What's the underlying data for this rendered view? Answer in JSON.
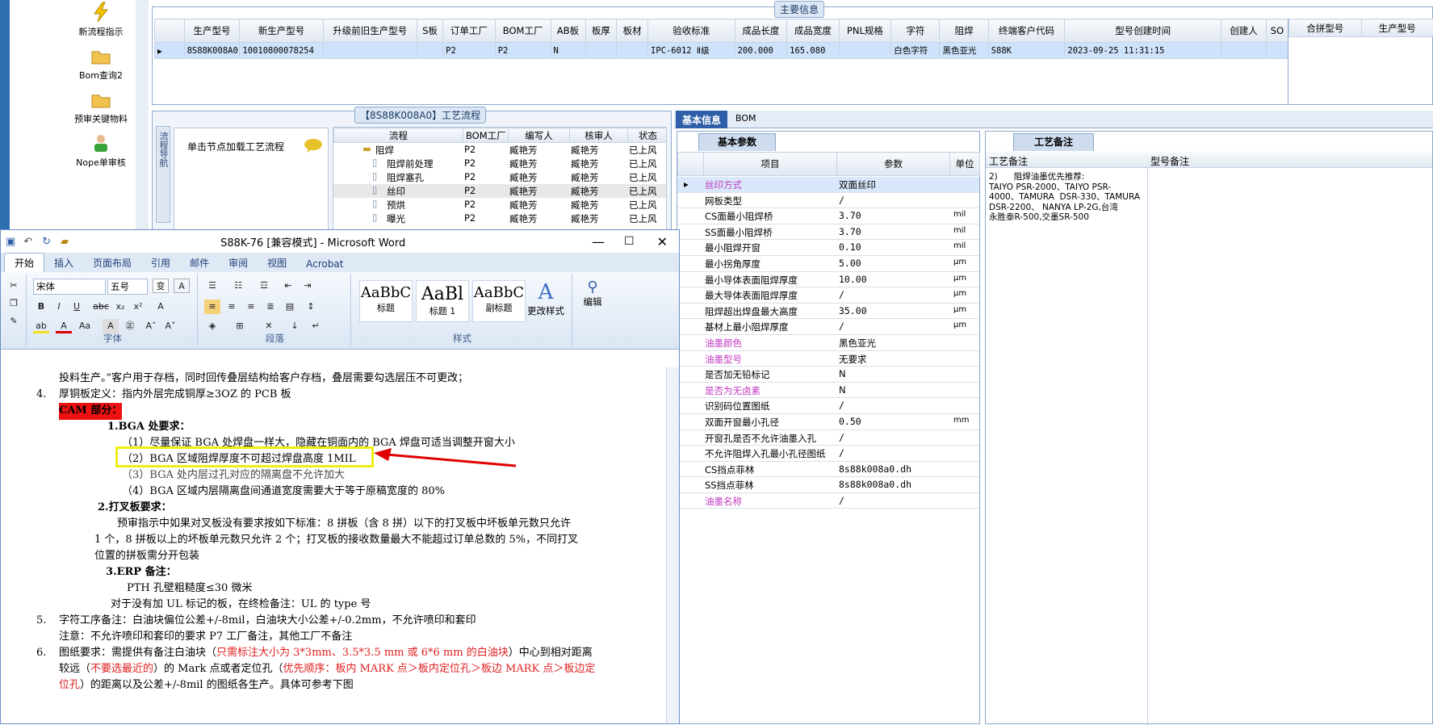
{
  "nav": {
    "items": [
      "新流程指示",
      "Bom查询2",
      "预审关键物料",
      "Nope单审核"
    ]
  },
  "main_info": {
    "title": "主要信息",
    "columns": [
      "生产型号",
      "新生产型号",
      "升级前旧生产型号",
      "S板",
      "订单工厂",
      "BOM工厂",
      "AB板",
      "板厚",
      "板材",
      "验收标准",
      "成品长度",
      "成品宽度",
      "PNL规格",
      "字符",
      "阻焊",
      "终端客户代码",
      "型号创建时间",
      "创建人",
      "SO"
    ],
    "row": [
      "8S88K008A0",
      "10010800078254",
      "",
      "",
      "P2",
      "P2",
      "N",
      "",
      "",
      "IPC-6012 Ⅱ级",
      "200.000",
      "165.080",
      "",
      "白色字符",
      "黑色亚光",
      "S88K",
      "2023-09-25 11:31:15",
      "",
      ""
    ],
    "side_columns": [
      "合拼型号",
      "生产型号"
    ]
  },
  "process": {
    "title": "【8S88K008A0】工艺流程",
    "side_tab": "流程导航",
    "hint": "单击节点加载工艺流程",
    "columns": [
      "流程",
      "BOM工厂",
      "编写人",
      "核审人",
      "状态"
    ],
    "rows": [
      [
        "阻焊",
        "P2",
        "臧艳芳",
        "臧艳芳",
        "已上风"
      ],
      [
        "阻焊前处理",
        "P2",
        "臧艳芳",
        "臧艳芳",
        "已上风"
      ],
      [
        "阻焊塞孔",
        "P2",
        "臧艳芳",
        "臧艳芳",
        "已上风"
      ],
      [
        "丝印",
        "P2",
        "臧艳芳",
        "臧艳芳",
        "已上风"
      ],
      [
        "预烘",
        "P2",
        "臧艳芳",
        "臧艳芳",
        "已上风"
      ],
      [
        "曝光",
        "P2",
        "臧艳芳",
        "臧艳芳",
        "已上风"
      ]
    ]
  },
  "right_tabs": [
    "基本信息",
    "BOM"
  ],
  "params": {
    "tab": "基本参数",
    "columns": [
      "项目",
      "参数",
      "单位"
    ],
    "rows": [
      [
        "丝印方式",
        "双面丝印",
        ""
      ],
      [
        "网板类型",
        "/",
        ""
      ],
      [
        "CS面最小阻焊桥",
        "3.70",
        "mil"
      ],
      [
        "SS面最小阻焊桥",
        "3.70",
        "mil"
      ],
      [
        "最小阻焊开窗",
        "0.10",
        "mil"
      ],
      [
        "最小拐角厚度",
        "5.00",
        "μm"
      ],
      [
        "最小导体表面阻焊厚度",
        "10.00",
        "μm"
      ],
      [
        "最大导体表面阻焊厚度",
        "/",
        "μm"
      ],
      [
        "阻焊超出焊盘最大高度",
        "35.00",
        "μm"
      ],
      [
        "基材上最小阻焊厚度",
        "/",
        "μm"
      ],
      [
        "油墨颜色",
        "黑色亚光",
        ""
      ],
      [
        "油墨型号",
        "无要求",
        ""
      ],
      [
        "是否加无铅标记",
        "N",
        ""
      ],
      [
        "是否为无卤素",
        "N",
        ""
      ],
      [
        "识别码位置图纸",
        "/",
        ""
      ],
      [
        "双面开窗最小孔径",
        "0.50",
        "mm"
      ],
      [
        "开窗孔是否不允许油墨入孔",
        "/",
        ""
      ],
      [
        "不允许阻焊入孔最小孔径图纸",
        "/",
        ""
      ],
      [
        "CS挡点菲林",
        "8s88k008a0.dh",
        ""
      ],
      [
        "SS挡点菲林",
        "8s88k008a0.dh",
        ""
      ],
      [
        "油墨名称",
        "/",
        ""
      ]
    ],
    "purple_rows": [
      0,
      10,
      11,
      13,
      20
    ]
  },
  "notes": {
    "tab": "工艺备注",
    "col1": "工艺备注",
    "col2": "型号备注",
    "text": [
      "2)      阻焊油墨优先推荐:",
      "TAIYO PSR-2000、TAIYO PSR-",
      "4000、TAMURA  DSR-330、TAMURA",
      "DSR-2200、 NANYA LP-2G,台湾",
      "永胜泰R-500,交墨SR-500"
    ]
  },
  "word": {
    "title": "S88K-76 [兼容模式] - Microsoft Word",
    "tabs": [
      "开始",
      "插入",
      "页面布局",
      "引用",
      "邮件",
      "审阅",
      "视图",
      "Acrobat"
    ],
    "font": "宋体",
    "size": "五号",
    "groups": [
      "字体",
      "段落",
      "样式",
      "编辑"
    ],
    "styles": [
      {
        "sample": "AaBbC",
        "name": "标题"
      },
      {
        "sample": "AaBl",
        "name": "标题 1"
      },
      {
        "sample": "AaBbC",
        "name": "副标题"
      }
    ],
    "change_style": "更改样式",
    "edit": "编辑",
    "doc": {
      "l1": "投料生产。”客户用于存档，同时回传叠层结构给客户存档，叠层需要勾选层压不可更改；",
      "n4": "4.",
      "l2": "厚铜板定义：指内外层完成铜厚≥3OZ 的 PCB 板",
      "cam": "CAM 部分：",
      "bga": "1.BGA 处要求：",
      "b1": "（1）尽量保证 BGA 处焊盘一样大，隐藏在铜面内的 BGA 焊盘可适当调整开窗大小",
      "b2": "（2）BGA 区域阻焊厚度不可超过焊盘高度 1MIL",
      "b3": "（3）BGA 处内层过孔对应的隔离盘不允许加大",
      "b4": "（4）BGA 区域内层隔离盘间通道宽度需要大于等于原稿宽度的 80%",
      "dc": "2.打叉板要求：",
      "d1": "预审指示中如果对叉板没有要求按如下标准：8 拼板（含 8 拼）以下的打叉板中坏板单元数只允许",
      "d2": "1 个，8 拼板以上的坏板单元数只允许 2 个；打叉板的接收数量最大不能超过订单总数的 5%，不同打叉",
      "d3": "位置的拼板需分开包装",
      "erp": "3.ERP 备注：",
      "e1": "PTH 孔壁粗糙度≤30 微米",
      "e2": "对于没有加 UL 标记的板，在终检备注：UL 的 type 号",
      "n5": "5.",
      "c1": "字符工序备注：白油块偏位公差+/-8mil，白油块大小公差+/-0.2mm，不允许喷印和套印",
      "c2": "注意：不允许喷印和套印的要求 P7 工厂备注，其他工厂不备注",
      "n6": "6.",
      "f1a": "图纸要求：需提供有备注白油块（",
      "f1b": "只需标注大小为 3*3mm、3.5*3.5 mm 或 6*6 mm 的白油块",
      "f1c": "）中心到相对距离",
      "f2a": "较远（",
      "f2b": "不要选最近的",
      "f2c": "）的 Mark 点或者定位孔（",
      "f2d": "优先顺序：板内 MARK 点＞板内定位孔＞板边 MARK 点＞板边定",
      "f3a": "位孔",
      "f3b": "）的距离以及公差+/-8mil 的图纸各生产。具体可参考下图"
    }
  },
  "colors": {
    "accent": "#1f5fb0",
    "highlight": "#ffff00",
    "annotation_red": "#e00000"
  }
}
